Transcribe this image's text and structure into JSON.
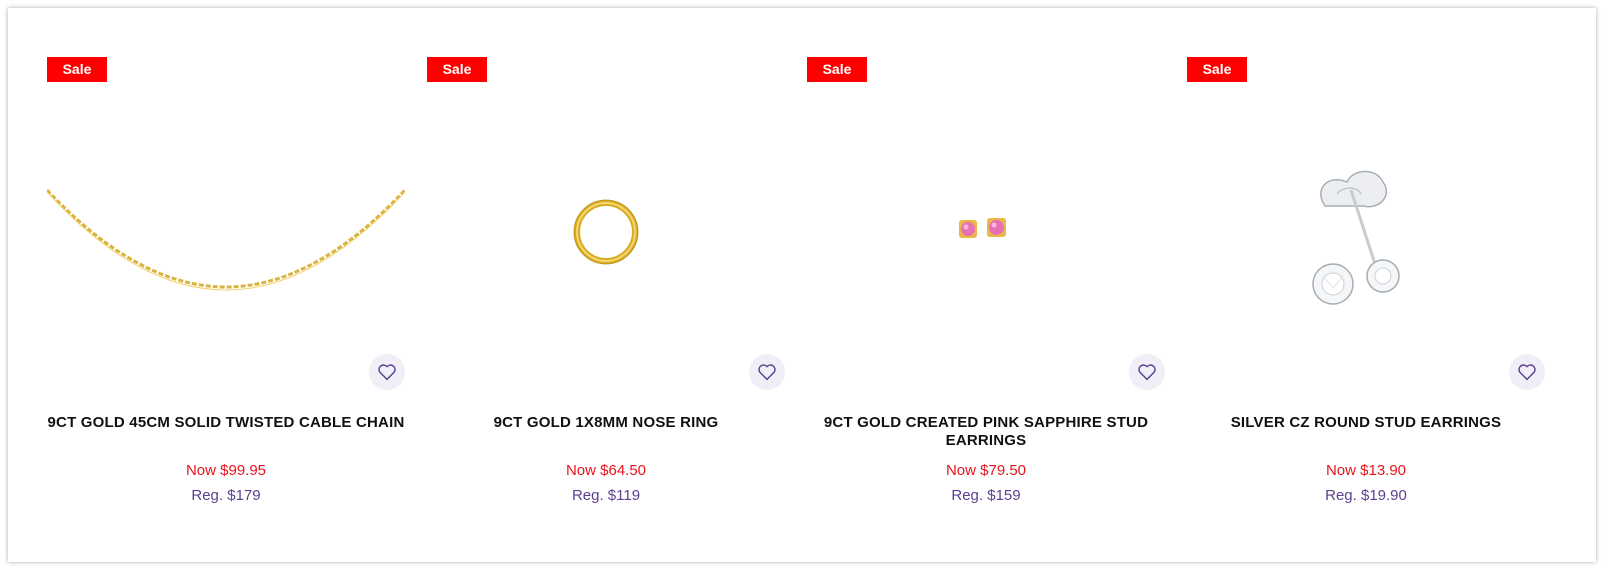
{
  "products": [
    {
      "badge": "Sale",
      "title": "9CT GOLD 45CM SOLID TWISTED CABLE CHAIN",
      "now_price": "Now $99.95",
      "reg_price": "Reg. $179"
    },
    {
      "badge": "Sale",
      "title": "9CT GOLD 1X8MM NOSE RING",
      "now_price": "Now $64.50",
      "reg_price": "Reg. $119"
    },
    {
      "badge": "Sale",
      "title": "9CT GOLD CREATED PINK SAPPHIRE STUD EARRINGS",
      "now_price": "Now $79.50",
      "reg_price": "Reg. $159"
    },
    {
      "badge": "Sale",
      "title": "SILVER CZ ROUND STUD EARRINGS",
      "now_price": "Now $13.90",
      "reg_price": "Reg. $19.90"
    }
  ],
  "icons": {
    "wishlist": "heart-icon"
  },
  "colors": {
    "sale_badge": "#ff0000",
    "now_price": "#e8141d",
    "reg_price": "#5c3f8f",
    "wishlist_bg": "#f0eff7",
    "wishlist_icon": "#5c3f8f"
  }
}
